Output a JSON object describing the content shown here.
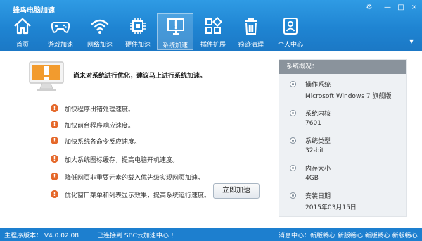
{
  "window": {
    "title": "蜂鸟电脑加速",
    "controls": {
      "settings": "⚙",
      "minimize": "—",
      "maximize": "□",
      "close": "×",
      "extra": "▾"
    }
  },
  "nav": [
    {
      "label": "首页",
      "icon": "home-icon"
    },
    {
      "label": "游戏加速",
      "icon": "gamepad-icon"
    },
    {
      "label": "网络加速",
      "icon": "wifi-icon"
    },
    {
      "label": "硬件加速",
      "icon": "chip-icon"
    },
    {
      "label": "系统加速",
      "icon": "monitor-alert-icon",
      "active": true
    },
    {
      "label": "插件扩展",
      "icon": "plugin-grid-icon"
    },
    {
      "label": "痕迹清理",
      "icon": "trash-icon"
    },
    {
      "label": "个人中心",
      "icon": "person-card-icon"
    }
  ],
  "main": {
    "alert_text": "尚未对系统进行优化，建议马上进行系统加速。",
    "items": [
      "加快程序出错处理速度。",
      "加快前台程序响应速度。",
      "加快系统各命令反应速度。",
      "加大系统图标缓存，提高电脑开机速度。",
      "降低网页非重要元素的载入优先级实现网页加速。",
      "优化窗口菜单和列表显示效果，提高系统运行速度。"
    ],
    "accelerate_button": "立即加速"
  },
  "sidebar": {
    "title": "系统概况：",
    "rows": [
      {
        "label": "操作系统",
        "value": "Microsoft Windows 7 旗舰版"
      },
      {
        "label": "系统内核",
        "value": "7601"
      },
      {
        "label": "系统类型",
        "value": "32-bit"
      },
      {
        "label": "内存大小",
        "value": "4GB"
      },
      {
        "label": "安装日期",
        "value": "2015年03月15日"
      }
    ]
  },
  "statusbar": {
    "version": "主程序版本： V4.0.02.08",
    "connection": "已连接到 SBC云加速中心 ！",
    "message": "消息中心：新版畅心 新版畅心 新版畅心 新版畅心"
  },
  "colors": {
    "header_top": "#2f9be4",
    "header_bottom": "#1b78c5",
    "statusbar": "#1d7fcf",
    "warning_dot": "#e5682a",
    "sidebar_title": "#8a939c",
    "sidebar_bg": "#eef1f4"
  }
}
